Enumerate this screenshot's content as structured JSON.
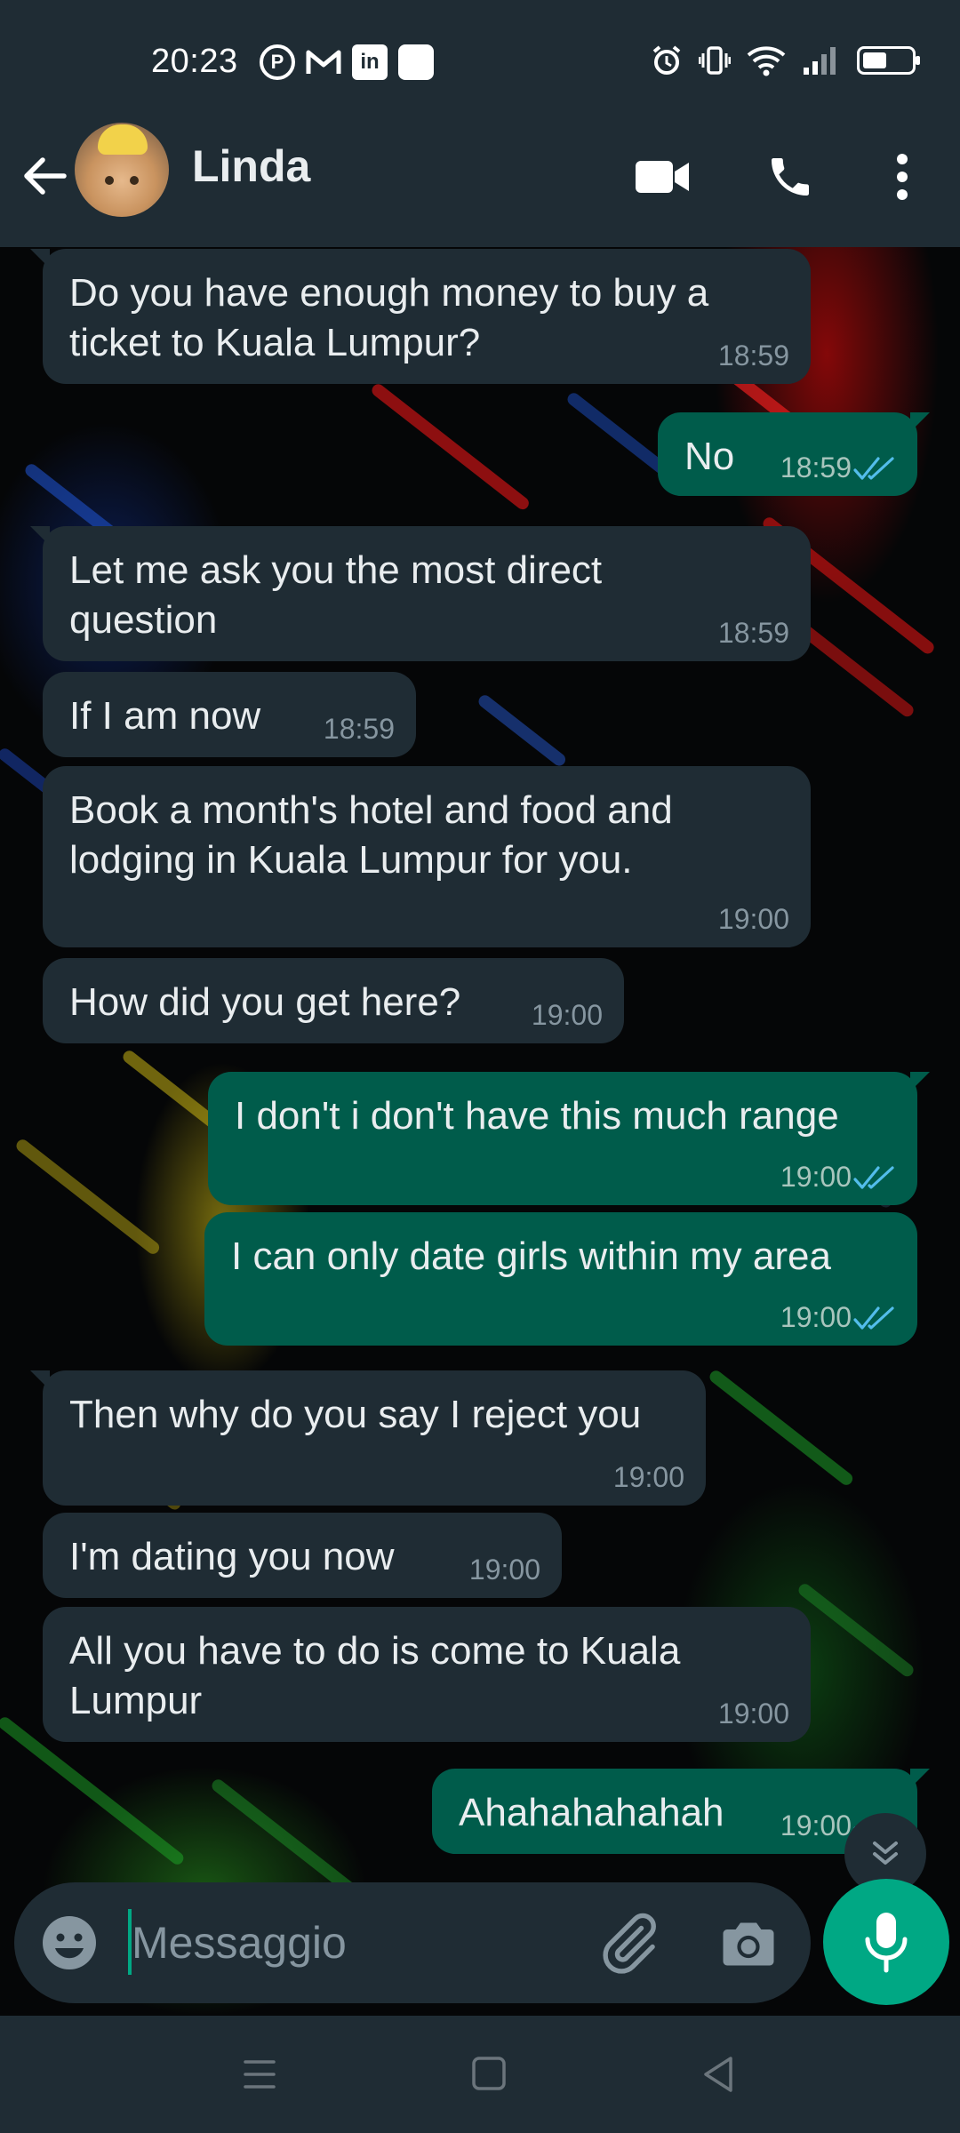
{
  "status_bar": {
    "time": "20:23",
    "notification_icons": [
      "pinterest-icon",
      "gmail-icon",
      "linkedin-icon",
      "app-notification-icon"
    ],
    "system_icons": [
      "alarm-icon",
      "vibrate-icon",
      "wifi-icon",
      "signal-icon",
      "battery-icon"
    ]
  },
  "header": {
    "contact_name": "Linda",
    "actions": [
      "video-call-icon",
      "voice-call-icon",
      "more-options-icon"
    ]
  },
  "messages": [
    {
      "direction": "in",
      "lines": [
        "Do you have enough money to buy a",
        "ticket to Kuala Lumpur?"
      ],
      "time": "18:59"
    },
    {
      "direction": "out",
      "lines": [
        "No"
      ],
      "time": "18:59",
      "status": "read"
    },
    {
      "direction": "in",
      "lines": [
        "Let me ask you the most direct",
        "question"
      ],
      "time": "18:59"
    },
    {
      "direction": "in",
      "lines": [
        "If I am now"
      ],
      "time": "18:59"
    },
    {
      "direction": "in",
      "lines": [
        "Book a month's hotel and food and",
        "lodging in Kuala Lumpur for you."
      ],
      "time": "19:00"
    },
    {
      "direction": "in",
      "lines": [
        "How did you get here?"
      ],
      "time": "19:00"
    },
    {
      "direction": "out",
      "lines": [
        "I don't i don't have this much range"
      ],
      "time": "19:00",
      "status": "read"
    },
    {
      "direction": "out",
      "lines": [
        "I can only date girls within my area"
      ],
      "time": "19:00",
      "status": "read"
    },
    {
      "direction": "in",
      "lines": [
        "Then why do you say I reject you"
      ],
      "time": "19:00"
    },
    {
      "direction": "in",
      "lines": [
        "I'm dating you now"
      ],
      "time": "19:00"
    },
    {
      "direction": "in",
      "lines": [
        "All you have to do is come to Kuala",
        "Lumpur"
      ],
      "time": "19:00"
    },
    {
      "direction": "out",
      "lines": [
        "Ahahahahahah"
      ],
      "time": "19:00",
      "status": "read"
    }
  ],
  "composer": {
    "placeholder": "Messaggio",
    "value": ""
  },
  "colors": {
    "header_bg": "#1f2c34",
    "incoming_bubble": "#1f2c34",
    "outgoing_bubble": "#005c4b",
    "accent": "#00a884",
    "read_ticks": "#53bdeb"
  }
}
